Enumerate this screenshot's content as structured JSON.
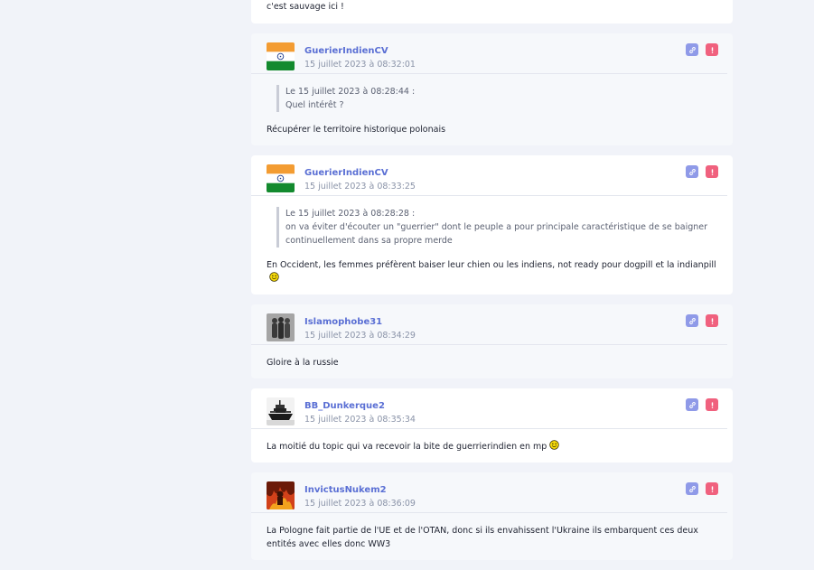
{
  "posts": [
    {
      "fragment": true,
      "message": "c'est sauvage ici !"
    },
    {
      "author": "GuerierIndienCV",
      "date": "15 juillet 2023 à 08:32:01",
      "avatar": "india-flag-avatar",
      "quote_head": "Le 15 juillet 2023 à 08:28:44 :",
      "quote_text": "Quel intérêt ?",
      "message": "Récupérer le territoire historique polonais",
      "smiley": false
    },
    {
      "author": "GuerierIndienCV",
      "date": "15 juillet 2023 à 08:33:25",
      "avatar": "india-flag-avatar",
      "quote_head": "Le 15 juillet 2023 à 08:28:28 :",
      "quote_text": "on va éviter d'écouter un \"guerrier\" dont le peuple a pour principale caractéristique de se baigner continuellement dans sa propre merde",
      "message": "En Occident, les femmes préfèrent baiser leur chien ou les indiens, not ready pour dogpill et la indianpill",
      "smiley": true
    },
    {
      "author": "Islamophobe31",
      "date": "15 juillet 2023 à 08:34:29",
      "avatar": "soldiers-avatar",
      "message": "Gloire à la russie",
      "smiley": false
    },
    {
      "author": "BB_Dunkerque2",
      "date": "15 juillet 2023 à 08:35:34",
      "avatar": "battleship-avatar",
      "message": "La moitié du topic qui va recevoir la bite de guerrierindien en mp",
      "smiley": true
    },
    {
      "author": "InvictusNukem2",
      "date": "15 juillet 2023 à 08:36:09",
      "avatar": "fire-avatar",
      "message": "La Pologne fait partie de l'UE et de l'OTAN, donc si ils envahissent l'Ukraine ils embarquent ces deux entités avec elles donc WW3",
      "smiley": false
    }
  ],
  "colors": {
    "page_bg": "#f1f3f9",
    "author": "#5a6fd4",
    "link_button": "#8f9ae8",
    "report_button": "#f0617e"
  },
  "icons": {
    "link": "link-icon",
    "report": "exclamation-icon",
    "smiley": "smiley-icon"
  }
}
